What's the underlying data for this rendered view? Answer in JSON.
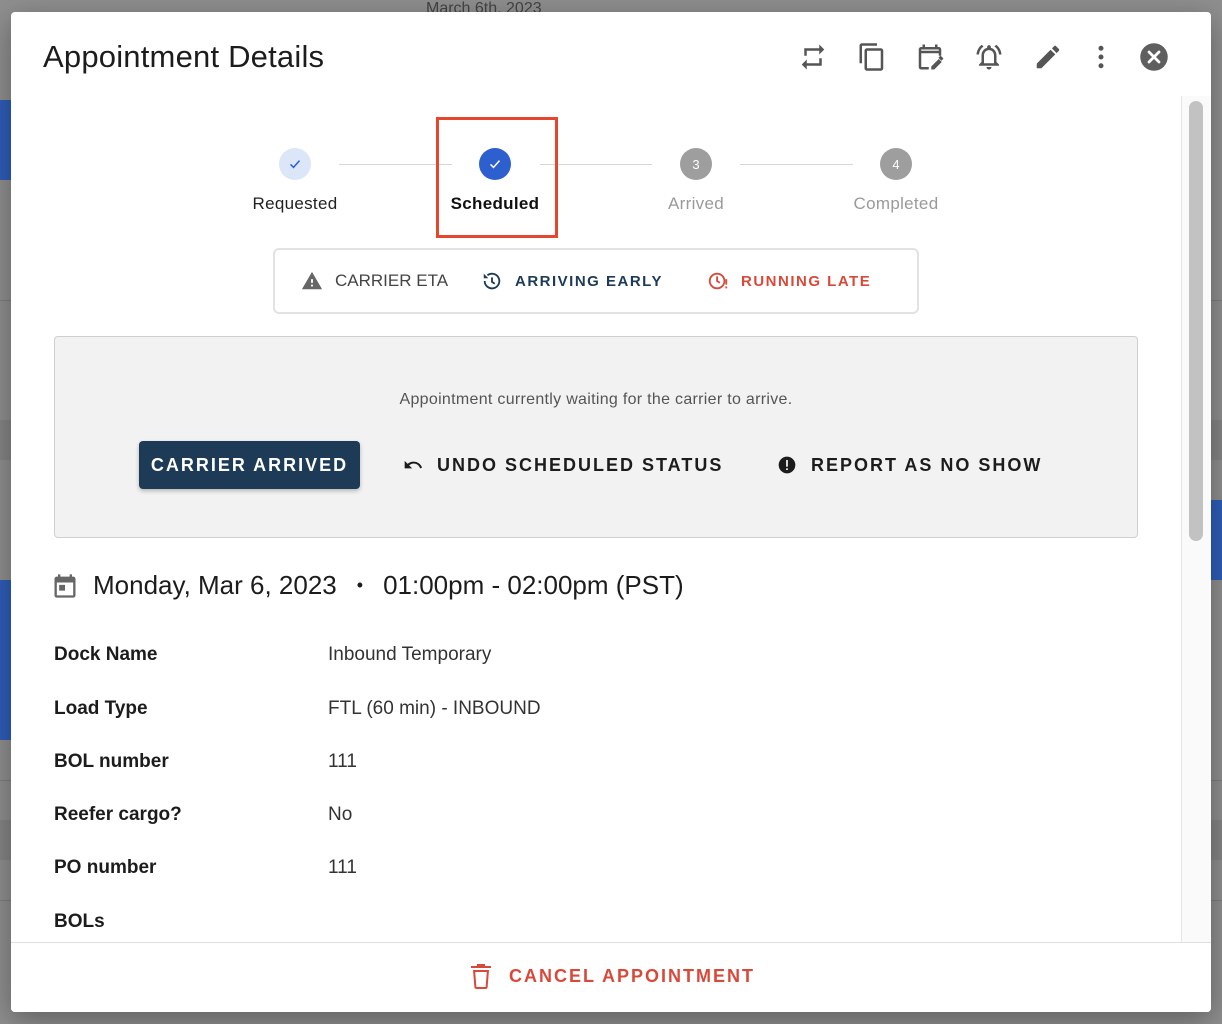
{
  "background": {
    "date_text": "March 6th, 2023"
  },
  "modal": {
    "title": "Appointment Details",
    "toolbar": [
      "repeat-icon",
      "copy-icon",
      "reschedule-icon",
      "notification-icon",
      "edit-icon",
      "more-vert-icon",
      "close-icon"
    ]
  },
  "stepper": {
    "steps": [
      {
        "label": "Requested",
        "number": "1",
        "state": "done"
      },
      {
        "label": "Scheduled",
        "number": "2",
        "state": "current"
      },
      {
        "label": "Arrived",
        "number": "3",
        "state": "pending"
      },
      {
        "label": "Completed",
        "number": "4",
        "state": "pending"
      }
    ]
  },
  "eta": {
    "title": "CARRIER ETA",
    "early_label": "ARRIVING EARLY",
    "late_label": "RUNNING LATE"
  },
  "status": {
    "message": "Appointment currently waiting for the carrier to arrive.",
    "primary_label": "CARRIER ARRIVED",
    "undo_label": "UNDO SCHEDULED STATUS",
    "no_show_label": "REPORT AS NO SHOW"
  },
  "schedule": {
    "date": "Monday, Mar 6, 2023",
    "separator": "•",
    "time": "01:00pm - 02:00pm (PST)"
  },
  "details": [
    {
      "label": "Dock Name",
      "value": "Inbound Temporary"
    },
    {
      "label": "Load Type",
      "value": "FTL (60 min) - INBOUND"
    },
    {
      "label": "BOL number",
      "value": "111"
    },
    {
      "label": "Reefer cargo?",
      "value": "No"
    },
    {
      "label": "PO number",
      "value": "111"
    },
    {
      "label": "BOLs",
      "value": ""
    }
  ],
  "footer": {
    "cancel_label": "CANCEL APPOINTMENT"
  },
  "colors": {
    "primary": "#1d3b57",
    "step_active": "#2d5fcf",
    "step_done_bg": "#dbe6f8",
    "danger": "#d9493a",
    "highlight": "#e6462d"
  }
}
